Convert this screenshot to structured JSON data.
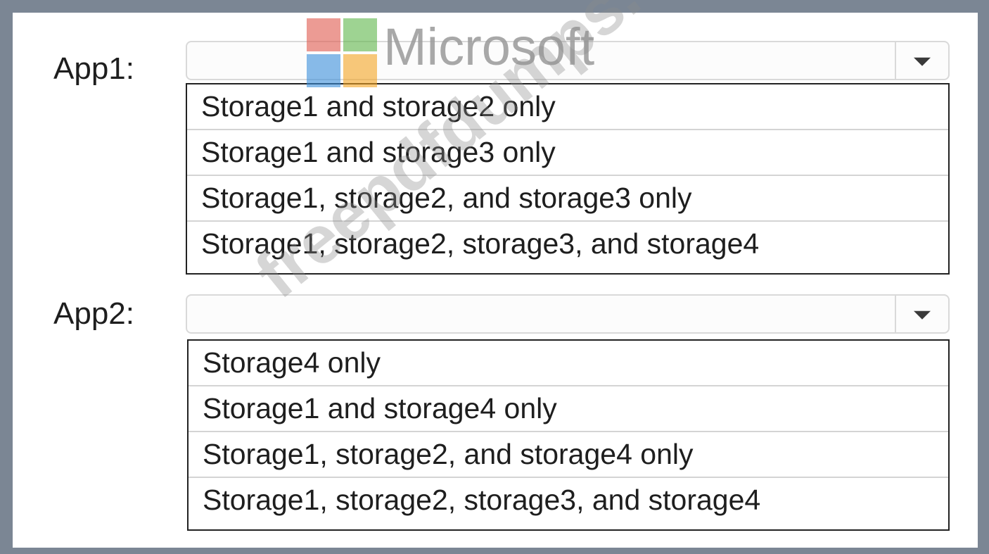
{
  "logo": {
    "text": "Microsoft",
    "icon": "microsoft-logo-icon"
  },
  "watermark": "freepdfdumps.com",
  "app1": {
    "label": "App1:",
    "selected": "",
    "options": [
      "Storage1 and storage2 only",
      "Storage1 and storage3 only",
      "Storage1, storage2, and storage3 only",
      "Storage1, storage2, storage3, and storage4"
    ]
  },
  "app2": {
    "label": "App2:",
    "selected": "",
    "options": [
      "Storage4 only",
      "Storage1 and storage4 only",
      "Storage1, storage2, and storage4 only",
      "Storage1, storage2, storage3, and storage4"
    ]
  }
}
